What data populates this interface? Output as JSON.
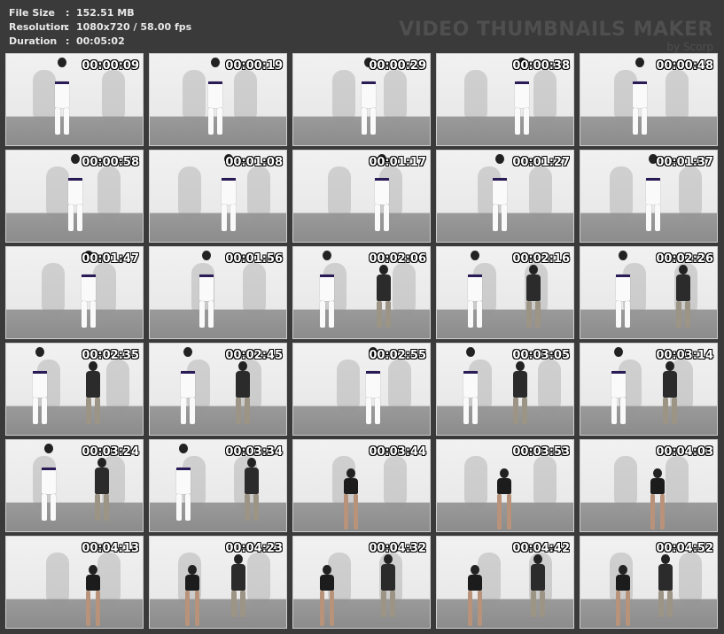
{
  "info": {
    "file_size_label": "File Size",
    "file_size_value": "152.51 MB",
    "resolution_label": "Resolution",
    "resolution_value": "1080x720 / 58.00 fps",
    "duration_label": "Duration",
    "duration_value": "00:05:02",
    "separator": ":"
  },
  "watermark": {
    "title": "VIDEO THUMBNAILS MAKER",
    "byline": "by Scorp"
  },
  "thumbnails": [
    {
      "time": "00:00:09",
      "figures": [
        "gi"
      ]
    },
    {
      "time": "00:00:19",
      "figures": [
        "gi"
      ]
    },
    {
      "time": "00:00:29",
      "figures": [
        "gi"
      ]
    },
    {
      "time": "00:00:38",
      "figures": [
        "gi"
      ]
    },
    {
      "time": "00:00:48",
      "figures": [
        "gi"
      ]
    },
    {
      "time": "00:00:58",
      "figures": [
        "gi"
      ]
    },
    {
      "time": "00:01:08",
      "figures": [
        "gi"
      ]
    },
    {
      "time": "00:01:17",
      "figures": [
        "gi"
      ]
    },
    {
      "time": "00:01:27",
      "figures": [
        "gi"
      ]
    },
    {
      "time": "00:01:37",
      "figures": [
        "gi"
      ]
    },
    {
      "time": "00:01:47",
      "figures": [
        "gi"
      ]
    },
    {
      "time": "00:01:56",
      "figures": [
        "gi"
      ]
    },
    {
      "time": "00:02:06",
      "figures": [
        "gi",
        "dark"
      ]
    },
    {
      "time": "00:02:16",
      "figures": [
        "gi",
        "dark"
      ]
    },
    {
      "time": "00:02:26",
      "figures": [
        "gi",
        "dark"
      ]
    },
    {
      "time": "00:02:35",
      "figures": [
        "gi",
        "dark"
      ]
    },
    {
      "time": "00:02:45",
      "figures": [
        "gi",
        "dark"
      ]
    },
    {
      "time": "00:02:55",
      "figures": [
        "gi"
      ]
    },
    {
      "time": "00:03:05",
      "figures": [
        "gi",
        "dark"
      ]
    },
    {
      "time": "00:03:14",
      "figures": [
        "gi",
        "dark"
      ]
    },
    {
      "time": "00:03:24",
      "figures": [
        "gi",
        "dark"
      ]
    },
    {
      "time": "00:03:34",
      "figures": [
        "gi",
        "dark"
      ]
    },
    {
      "time": "00:03:44",
      "figures": [
        "dress"
      ]
    },
    {
      "time": "00:03:53",
      "figures": [
        "dress"
      ]
    },
    {
      "time": "00:04:03",
      "figures": [
        "dress"
      ]
    },
    {
      "time": "00:04:13",
      "figures": [
        "dress"
      ]
    },
    {
      "time": "00:04:23",
      "figures": [
        "dress",
        "dark"
      ]
    },
    {
      "time": "00:04:32",
      "figures": [
        "dress",
        "dark"
      ]
    },
    {
      "time": "00:04:42",
      "figures": [
        "dress",
        "dark"
      ]
    },
    {
      "time": "00:04:52",
      "figures": [
        "dress",
        "dark"
      ]
    }
  ]
}
